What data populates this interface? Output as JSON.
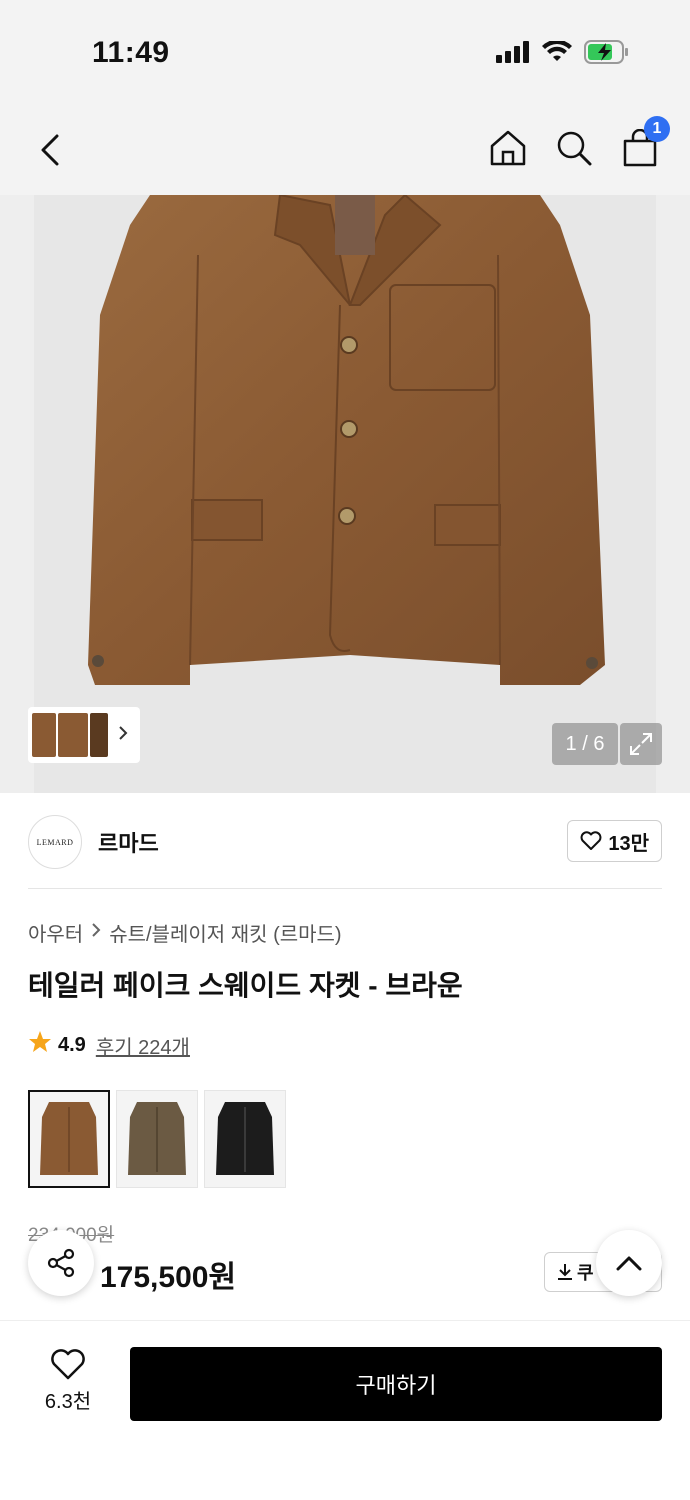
{
  "status": {
    "time": "11:49"
  },
  "nav": {
    "cart_count": "1"
  },
  "hero": {
    "counter": "1 / 6"
  },
  "brand": {
    "logo_text": "LEMARD",
    "name": "르마드",
    "likes": "13만"
  },
  "breadcrumb": {
    "category": "아우터",
    "subcategory": "슈트/블레이저 재킷 (르마드)"
  },
  "product": {
    "title": "테일러 페이크 스웨이드 자켓 - 브라운",
    "rating": "4.9",
    "reviews": "후기 224개",
    "price_original": "234,000원",
    "price_now": "175,500원",
    "coupon_label": "쿠"
  },
  "colors": {
    "brown": "#8a5a33",
    "khaki": "#6b5a43",
    "black": "#1c1c1c",
    "accent_blue": "#2f6ff2",
    "star": "#f6a51a"
  },
  "bottom": {
    "likes": "6.3천",
    "buy_label": "구매하기"
  }
}
